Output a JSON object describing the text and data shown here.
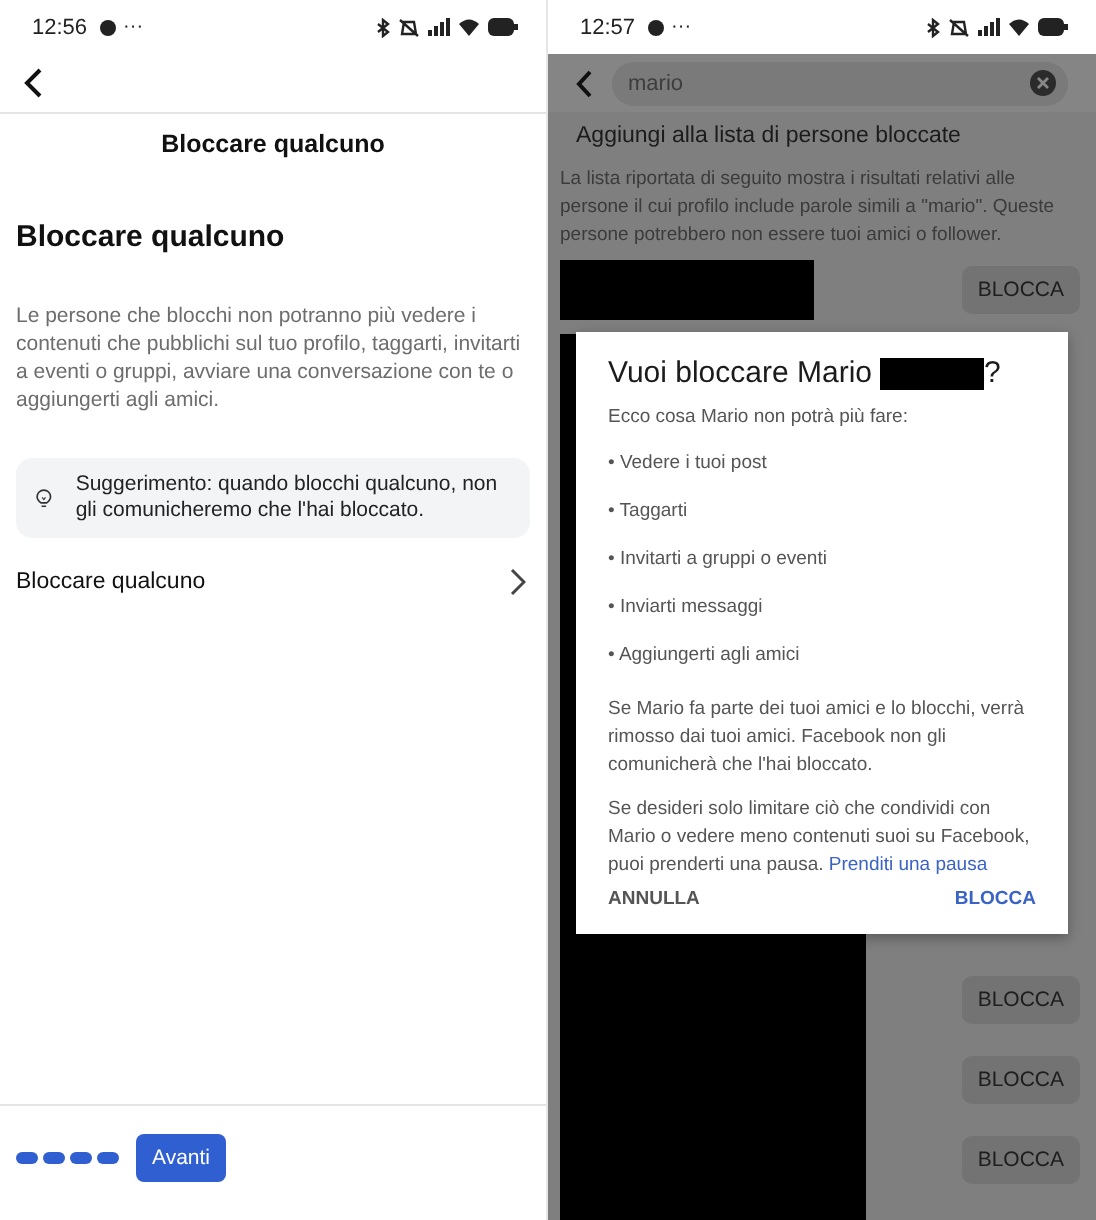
{
  "left": {
    "status": {
      "time": "12:56",
      "more": "···"
    },
    "title": "Bloccare qualcuno",
    "heading": "Bloccare qualcuno",
    "description": "Le persone che blocchi non potranno più vedere i contenuti che pubblichi sul tuo profilo, taggarti, invitarti a eventi o gruppi, avviare una conversazione con te o aggiungerti agli amici.",
    "tip": "Suggerimento: quando blocchi qualcuno, non gli comunicheremo che l'hai bloccato.",
    "row": "Bloccare qualcuno",
    "next_button": "Avanti"
  },
  "right": {
    "status": {
      "time": "12:57",
      "more": "···"
    },
    "search": {
      "value": "mario"
    },
    "heading": "Aggiungi alla lista di persone bloccate",
    "description": "La lista riportata di seguito mostra i risultati relativi alle persone il cui profilo include parole simili a \"mario\". Queste persone potrebbero non essere tuoi amici o follower.",
    "results": [
      {
        "action": "BLOCCA"
      },
      {
        "action": "BLOCCA"
      },
      {
        "action": "BLOCCA"
      },
      {
        "action": "BLOCCA"
      }
    ],
    "dialog": {
      "title": "Vuoi bloccare Mario",
      "title_end": "?",
      "intro": "Ecco cosa Mario non potrà più fare:",
      "items": [
        "• Vedere i tuoi post",
        "• Taggarti",
        "• Invitarti a gruppi o eventi",
        "• Inviarti messaggi",
        "• Aggiungerti agli amici"
      ],
      "note": "Se Mario fa parte dei tuoi amici e lo blocchi, verrà rimosso dai tuoi amici. Facebook non gli comunicherà che l'hai bloccato.",
      "limit_text": "Se desideri solo limitare ciò che condividi con Mario o vedere meno contenuti suoi su Facebook, puoi prenderti una pausa.",
      "limit_link": "Prenditi una pausa",
      "buttons": [
        {
          "label": "ANNULLA",
          "kind": "cancel"
        },
        {
          "label": "BLOCCA",
          "kind": "confirm"
        }
      ]
    }
  }
}
